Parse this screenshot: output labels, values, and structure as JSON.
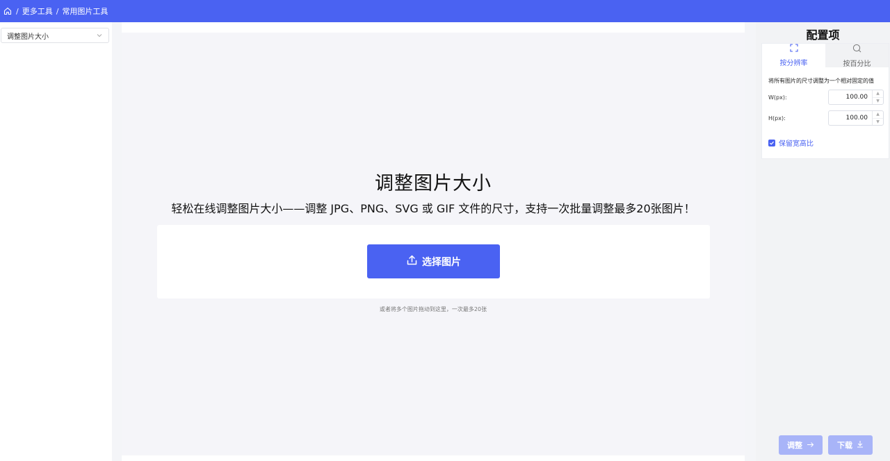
{
  "breadcrumb": {
    "items": [
      "更多工具",
      "常用图片工具"
    ],
    "separator": "/"
  },
  "left": {
    "select_value": "调整图片大小"
  },
  "main": {
    "title": "调整图片大小",
    "subtitle": "轻松在线调整图片大小——调整 JPG、PNG、SVG 或 GIF 文件的尺寸，支持一次批量调整最多20张图片！",
    "upload_button": "选择图片",
    "drop_hint": "或者将多个图片拖动到这里，一次最多20张"
  },
  "config": {
    "title": "配置项",
    "tabs": [
      {
        "label": "按分辨率",
        "icon": "crop-frame-icon",
        "active": true
      },
      {
        "label": "按百分比",
        "icon": "magnifier-icon",
        "active": false
      }
    ],
    "description": "将所有图片的尺寸调整为一个相对固定的值",
    "width_label": "W(px):",
    "width_value": "100.00",
    "height_label": "H(px):",
    "height_value": "100.00",
    "keep_ratio_label": "保留宽高比",
    "keep_ratio_checked": true
  },
  "actions": {
    "adjust_label": "调整",
    "download_label": "下载"
  },
  "colors": {
    "primary": "#4a62f2",
    "disabled_primary": "#a8b4f8",
    "main_bg": "#f5f5f9"
  }
}
